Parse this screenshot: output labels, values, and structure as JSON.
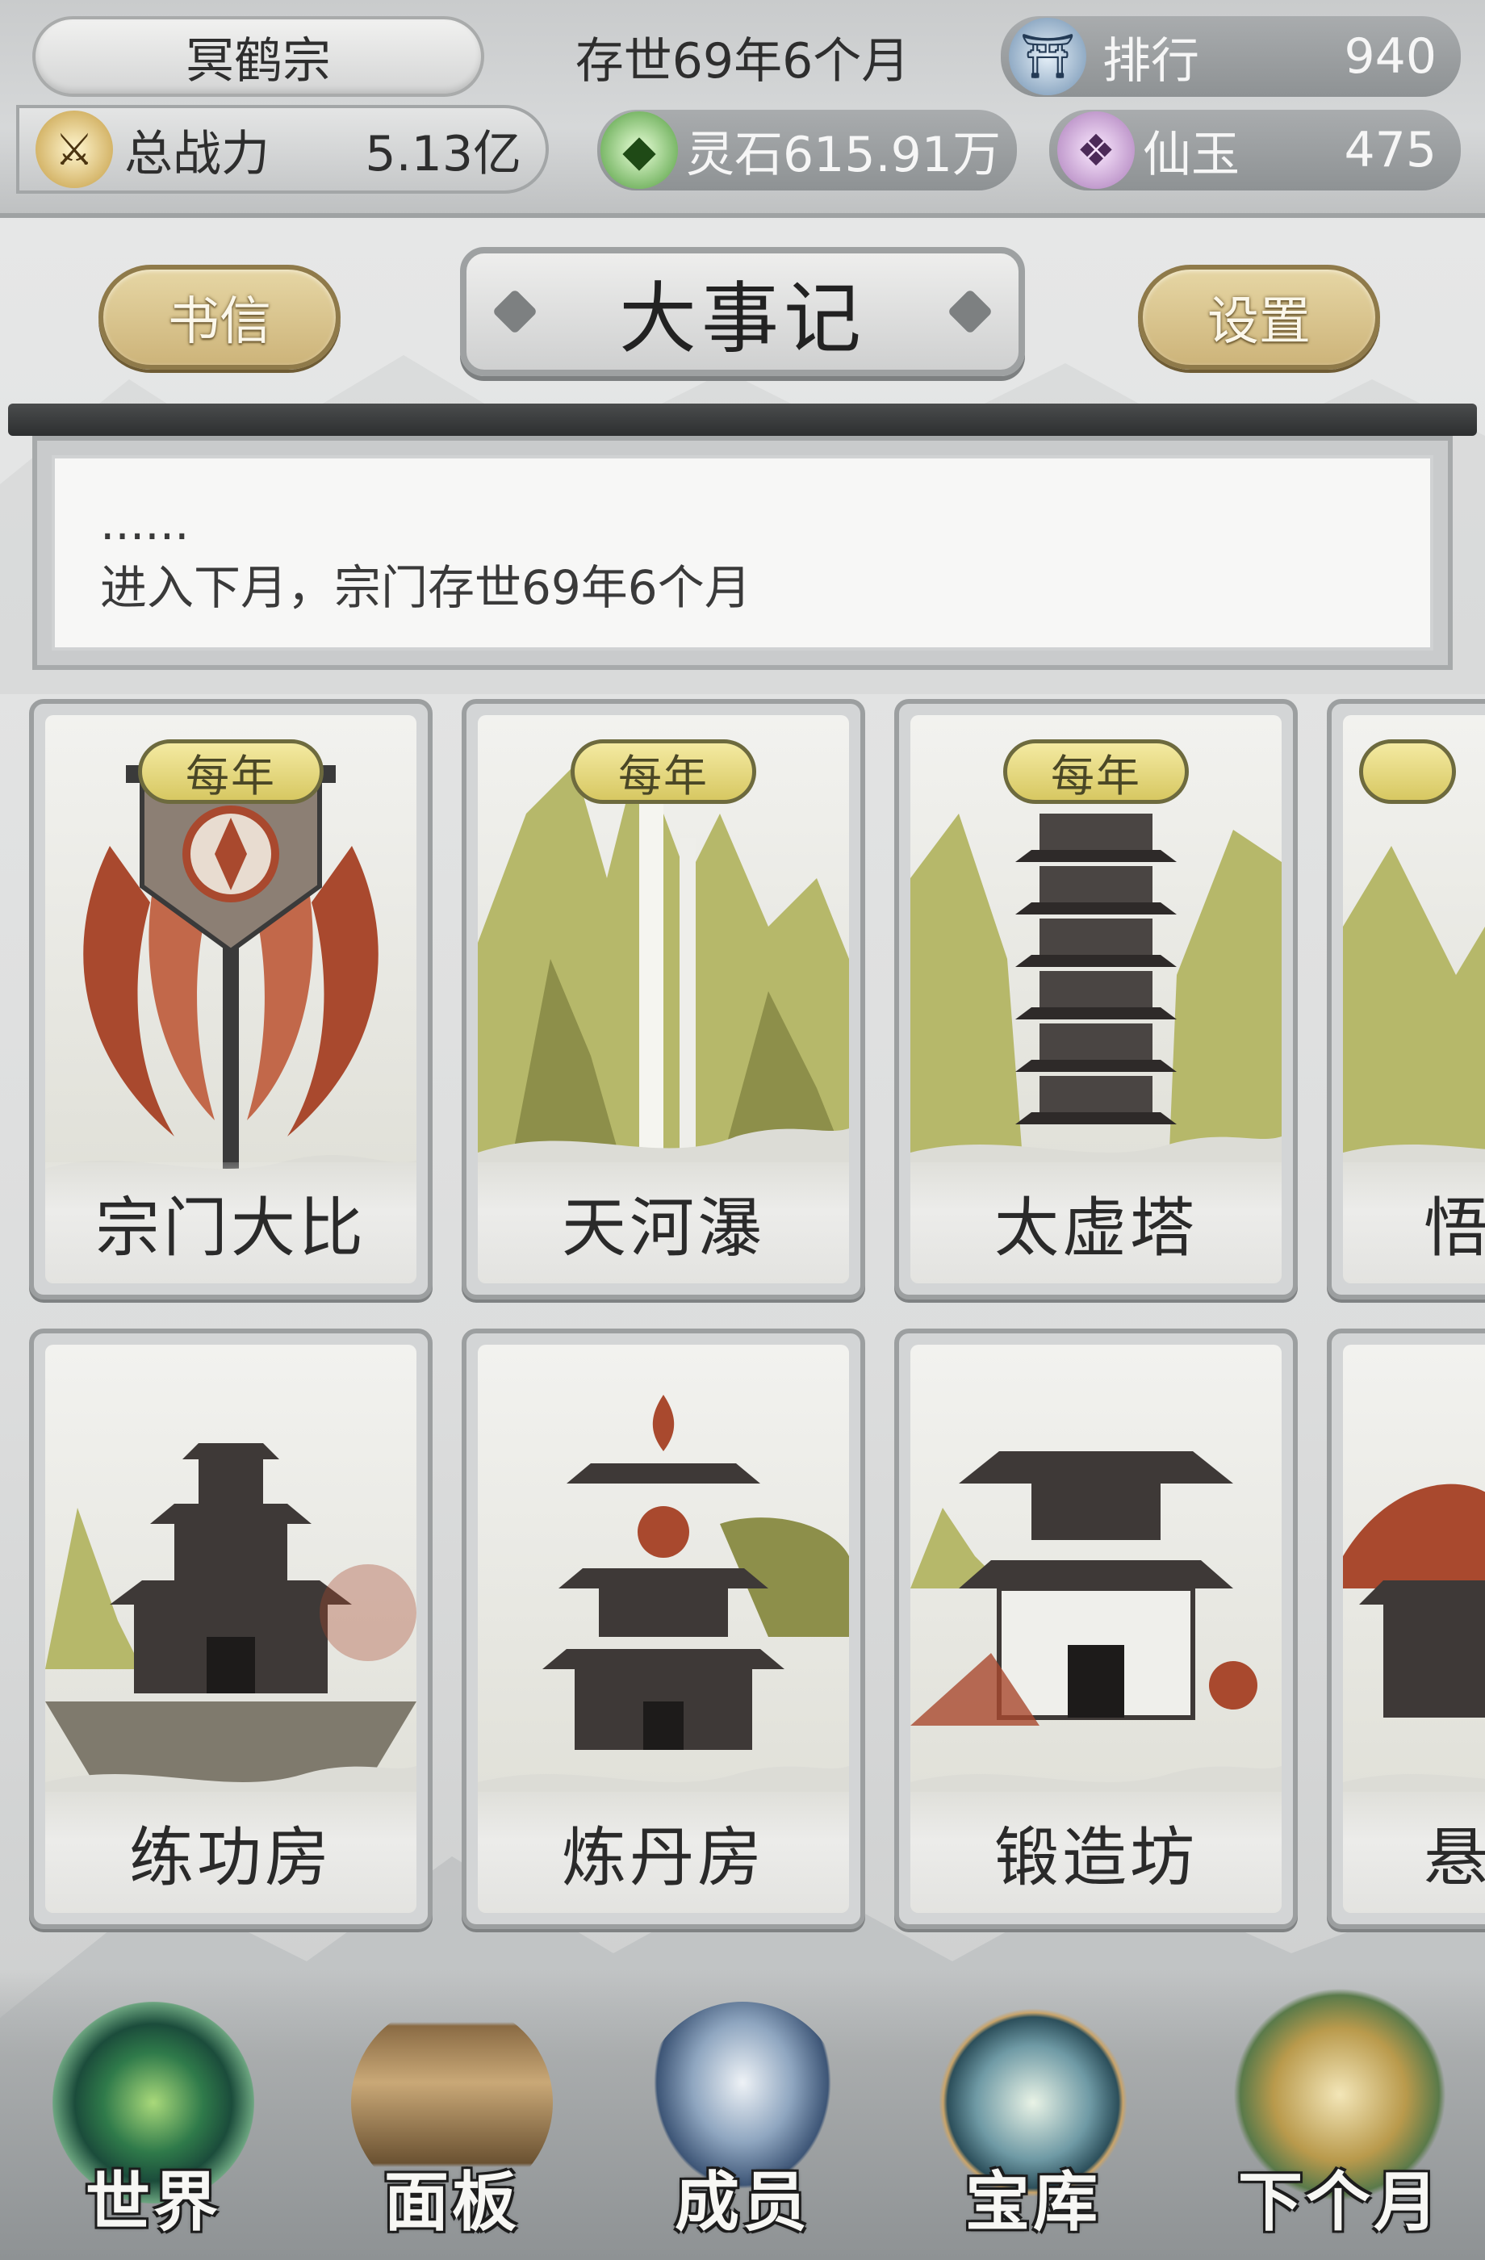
{
  "status": {
    "sect_name": "冥鹤宗",
    "sect_age": "存世69年6个月",
    "rank_label": "排行",
    "rank_value": "940",
    "power_label": "总战力",
    "power_value": "5.13亿",
    "spirit_stone": "灵石615.91万",
    "xianyu_label": "仙玉",
    "xianyu_value": "475"
  },
  "header": {
    "letters_label": "书信",
    "title": "大事记",
    "settings_label": "设置"
  },
  "log": {
    "ellipsis": "......",
    "message": "进入下月，宗门存世69年6个月"
  },
  "buildings": [
    {
      "name": "宗门大比",
      "badge": "每年"
    },
    {
      "name": "天河瀑",
      "badge": "每年"
    },
    {
      "name": "太虚塔",
      "badge": "每年"
    },
    {
      "name": "悟",
      "badge": ""
    },
    {
      "name": "练功房",
      "badge": ""
    },
    {
      "name": "炼丹房",
      "badge": ""
    },
    {
      "name": "锻造坊",
      "badge": ""
    },
    {
      "name": "悬",
      "badge": ""
    }
  ],
  "nav": [
    {
      "label": "世界",
      "icon": "world-emblem-icon"
    },
    {
      "label": "面板",
      "icon": "scroll-panel-icon"
    },
    {
      "label": "成员",
      "icon": "member-portrait-icon"
    },
    {
      "label": "宝库",
      "icon": "yin-yang-vault-icon"
    },
    {
      "label": "下个月",
      "icon": "next-month-emblem-icon"
    }
  ],
  "colors": {
    "badge_gold": "#d7c862",
    "button_gold": "#cdb47a",
    "banner_red": "#a9492e",
    "mountain_green": "#b6b86a"
  }
}
